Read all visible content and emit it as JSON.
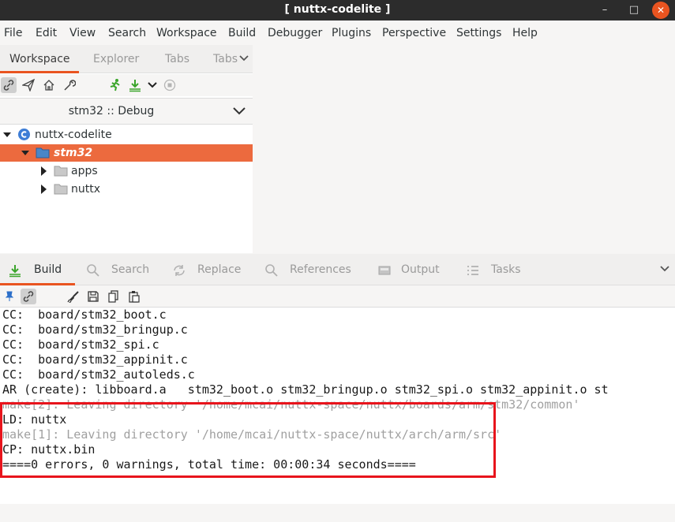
{
  "window": {
    "title": "[ nuttx-codelite ]",
    "minimize": "–",
    "maximize": "□",
    "close": "✕"
  },
  "menu": [
    "File",
    "Edit",
    "View",
    "Search",
    "Workspace",
    "Build",
    "Debugger",
    "Plugins",
    "Perspective",
    "Settings",
    "Help"
  ],
  "left_tabs": [
    "Workspace",
    "Explorer",
    "Tabs",
    "Tabs"
  ],
  "workspace_icons": [
    "link-icon",
    "paper-plane-icon",
    "home-icon",
    "wrench-icon",
    "run-icon",
    "build-icon",
    "dropdown-arrow-icon",
    "stop-icon"
  ],
  "configuration": "stm32 :: Debug",
  "tree": [
    {
      "label": "nuttx-codelite",
      "icon": "workspace-icon"
    },
    {
      "label": "stm32",
      "icon": "folder-icon"
    },
    {
      "label": "apps",
      "icon": "folder-icon"
    },
    {
      "label": "nuttx",
      "icon": "folder-icon"
    }
  ],
  "bottom_tabs": [
    "Build",
    "Search",
    "Replace",
    "References",
    "Output",
    "Tasks"
  ],
  "build_toolbar_icons": [
    "pin-icon",
    "link-icon",
    "broom-icon",
    "save-icon",
    "copy-icon",
    "paste-icon"
  ],
  "build_output": [
    "CC:  board/stm32_boot.c",
    "CC:  board/stm32_bringup.c",
    "CC:  board/stm32_spi.c",
    "CC:  board/stm32_appinit.c",
    "CC:  board/stm32_autoleds.c",
    "AR (create): libboard.a   stm32_boot.o stm32_bringup.o stm32_spi.o stm32_appinit.o st",
    "make[2]: Leaving directory '/home/mcai/nuttx-space/nuttx/boards/arm/stm32/common'",
    "LD: nuttx",
    "make[1]: Leaving directory '/home/mcai/nuttx-space/nuttx/arch/arm/src'",
    "CP: nuttx.bin",
    "====0 errors, 0 warnings, total time: 00:00:34 seconds===="
  ],
  "colors": {
    "accent": "#e95420",
    "selection": "#ec6a3e",
    "highlight_box": "#e8141c",
    "titlebar": "#2c2c2c"
  }
}
